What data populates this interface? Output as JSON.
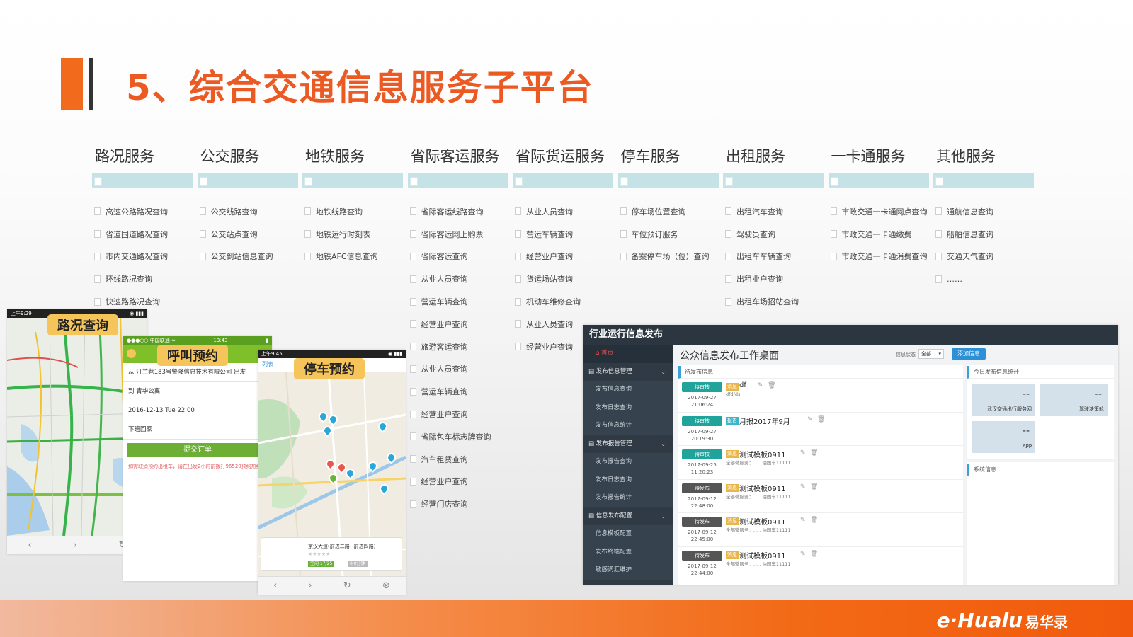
{
  "title": "5、综合交通信息服务子平台",
  "services": [
    {
      "name": "路况服务",
      "items": [
        "高速公路路况查询",
        "省道国道路况查询",
        "市内交通路况查询",
        "环线路况查询",
        "快速路路况查询"
      ]
    },
    {
      "name": "公交服务",
      "items": [
        "公交线路查询",
        "公交站点查询",
        "公交到站信息查询"
      ]
    },
    {
      "name": "地铁服务",
      "items": [
        "地铁线路查询",
        "地铁运行时刻表",
        "地铁AFC信息查询"
      ]
    },
    {
      "name": "省际客运服务",
      "items": [
        "省际客运线路查询",
        "省际客运网上购票",
        "省际客运查询",
        "从业人员查询",
        "营运车辆查询",
        "经营业户查询",
        "旅游客运查询",
        "从业人员查询",
        "营运车辆查询",
        "经营业户查询",
        "省际包车标志牌查询",
        "汽车租赁查询",
        "经营业户查询",
        "经营门店查询"
      ]
    },
    {
      "name": "省际货运服务",
      "items": [
        "从业人员查询",
        "营运车辆查询",
        "经营业户查询",
        "货运场站查询",
        "机动车维修查询",
        "从业人员查询",
        "经营业户查询"
      ]
    },
    {
      "name": "停车服务",
      "items": [
        "停车场位置查询",
        "车位预订服务",
        "备案停车场（位）查询"
      ]
    },
    {
      "name": "出租服务",
      "items": [
        "出租汽车查询",
        "驾驶员查询",
        "出租车车辆查询",
        "出租业户查询",
        "出租车场招站查询"
      ]
    },
    {
      "name": "一卡通服务",
      "items": [
        "市政交通一卡通网点查询",
        "市政交通一卡通缴费",
        "市政交通一卡通消费查询"
      ]
    },
    {
      "name": "其他服务",
      "items": [
        "通航信息查询",
        "船舶信息查询",
        "交通天气查询",
        "……"
      ]
    }
  ],
  "phones": {
    "traffic": {
      "label": "路况查询",
      "time": "上午9:29"
    },
    "taxi": {
      "label": "呼叫预约",
      "carrier": "●●●○○ 中国联通 ≈",
      "time": "13:43",
      "from": "从 汀兰巷183号警隆信息技术有限公司 出发",
      "to": "到 青华公寓",
      "datetime": "2016-12-13 Tue 22:00",
      "note": "下班回家",
      "submit": "提交订单",
      "hint": "如需取消预约出租车，请在出发2小时前拨打96520预约热线。"
    },
    "parking": {
      "label": "停车预约",
      "time": "上午9:45",
      "tab": "列表",
      "poi_name": "京汉大道(前进二路~前进四路)",
      "poi_avail": "空闲 17/25",
      "poi_dist": "0.0分钟"
    }
  },
  "admin": {
    "header": "行业运行信息发布",
    "sidebar": [
      {
        "label": "首页",
        "type": "home"
      },
      {
        "label": "发布信息管理",
        "type": "group"
      },
      {
        "label": "发布信息查询",
        "type": "sub"
      },
      {
        "label": "发布日志查询",
        "type": "sub"
      },
      {
        "label": "发布信息统计",
        "type": "sub"
      },
      {
        "label": "发布报告管理",
        "type": "group"
      },
      {
        "label": "发布报告查询",
        "type": "sub"
      },
      {
        "label": "发布日志查询",
        "type": "sub"
      },
      {
        "label": "发布报告统计",
        "type": "sub"
      },
      {
        "label": "信息发布配置",
        "type": "group"
      },
      {
        "label": "信息模板配置",
        "type": "sub"
      },
      {
        "label": "发布终端配置",
        "type": "sub"
      },
      {
        "label": "敏感词汇维护",
        "type": "sub"
      }
    ],
    "workspace_title": "公众信息发布工作桌面",
    "filter_label": "信息状态",
    "filter_value": "全部",
    "add_button": "添加信息",
    "pending_panel": "待发布信息",
    "messages": [
      {
        "status": "待审核",
        "kind": "review",
        "date": "2017-09-27",
        "time": "21:06:24",
        "tag": "消息",
        "title": "df",
        "sub": "dfdfds"
      },
      {
        "status": "待审核",
        "kind": "review",
        "date": "2017-09-27",
        "time": "20:19:30",
        "tag": "报告",
        "title": "月报2017年9月",
        "sub": ""
      },
      {
        "status": "待审核",
        "kind": "review",
        "date": "2017-09-25",
        "time": "11:20:23",
        "tag": "消息",
        "title": "测试模板0911",
        "sub": "全部微服务：. . . 泊国车11111"
      },
      {
        "status": "待发布",
        "kind": "pub",
        "date": "2017-09-12",
        "time": "22:48:00",
        "tag": "消息",
        "title": "测试模板0911",
        "sub": "全部微服务：. . . 泊国车11111"
      },
      {
        "status": "待发布",
        "kind": "pub",
        "date": "2017-09-12",
        "time": "22:45:00",
        "tag": "消息",
        "title": "测试模板0911",
        "sub": "全部微服务：. . . 泊国车11111"
      },
      {
        "status": "待发布",
        "kind": "pub",
        "date": "2017-09-12",
        "time": "22:44:00",
        "tag": "消息",
        "title": "测试模板0911",
        "sub": "全部微服务：. . . 泊国车11111"
      }
    ],
    "stats_panel": "今日发布信息统计",
    "stats": [
      {
        "value": "--",
        "label": "武汉交通出行服务网"
      },
      {
        "value": "--",
        "label": "驾驶决策舱"
      },
      {
        "value": "--",
        "label": "APP"
      }
    ],
    "system_panel": "系统信息"
  },
  "footer": {
    "logo": "e·Hualu",
    "logo_cn": "易华录"
  },
  "colors": {
    "accent": "#ec5a24",
    "band": "#c5e3e7",
    "admin_dark": "#2b3640",
    "review": "#1fa39a"
  }
}
